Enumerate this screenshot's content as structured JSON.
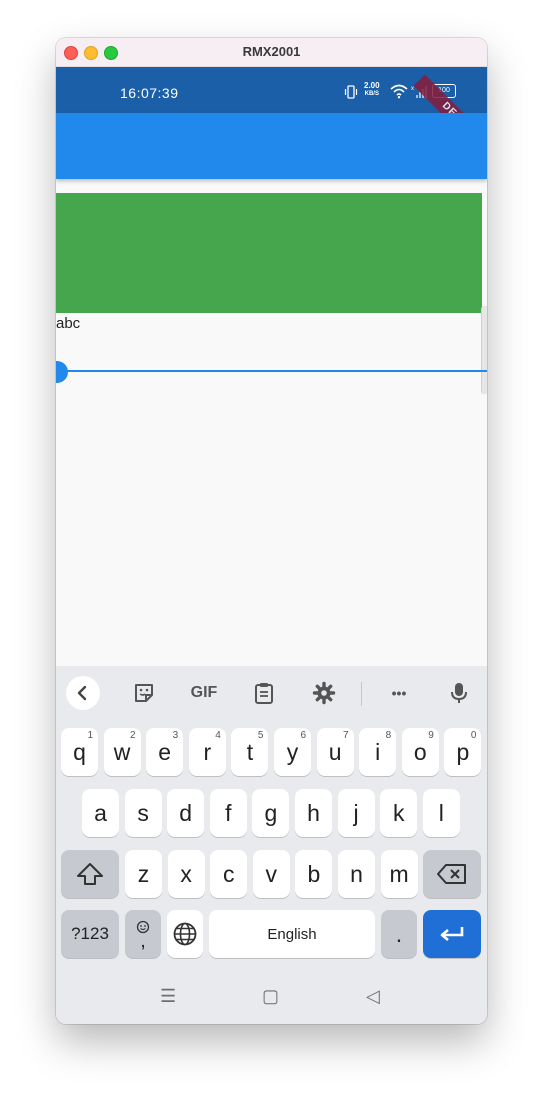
{
  "window": {
    "title": "RMX2001"
  },
  "status_bar": {
    "time": "16:07:39",
    "speed_value": "2.00",
    "speed_unit": "KB/S",
    "battery": "100",
    "debug_banner": "DEBUG"
  },
  "content": {
    "text": "abc",
    "slider_value": 0.0,
    "colors": {
      "appbar": "#2189ec",
      "green_box": "#46a64d",
      "accent": "#2189ec"
    }
  },
  "keyboard": {
    "toolbar": [
      "back-icon",
      "sticker-icon",
      "GIF",
      "clipboard-icon",
      "gear-icon",
      "more-icon",
      "mic-icon"
    ],
    "gif_label": "GIF",
    "more_label": "•••",
    "row1": [
      {
        "key": "q",
        "hint": "1"
      },
      {
        "key": "w",
        "hint": "2"
      },
      {
        "key": "e",
        "hint": "3"
      },
      {
        "key": "r",
        "hint": "4"
      },
      {
        "key": "t",
        "hint": "5"
      },
      {
        "key": "y",
        "hint": "6"
      },
      {
        "key": "u",
        "hint": "7"
      },
      {
        "key": "i",
        "hint": "8"
      },
      {
        "key": "o",
        "hint": "9"
      },
      {
        "key": "p",
        "hint": "0"
      }
    ],
    "row2": [
      "a",
      "s",
      "d",
      "f",
      "g",
      "h",
      "j",
      "k",
      "l"
    ],
    "row3": [
      "z",
      "x",
      "c",
      "v",
      "b",
      "n",
      "m"
    ],
    "symbols_label": "?123",
    "emoji_comma": ",",
    "space_label": "English",
    "period_label": ".",
    "nav": {
      "recents": "☰",
      "home": "▢",
      "back": "◁"
    }
  }
}
